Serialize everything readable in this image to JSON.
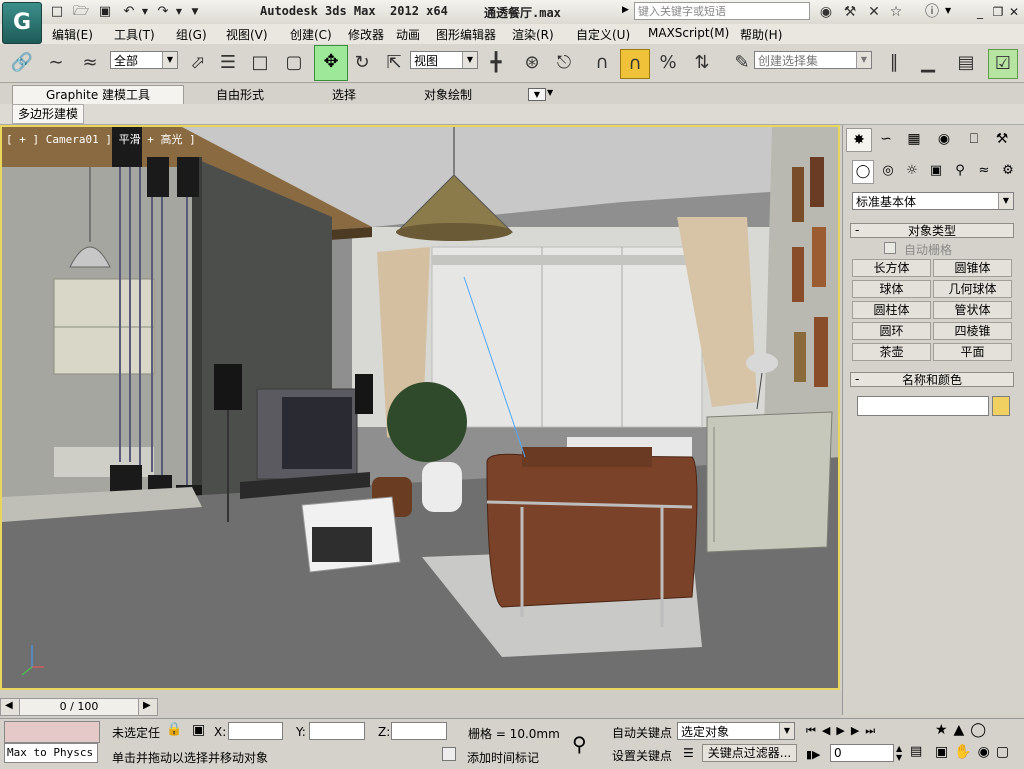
{
  "app_title": "Autodesk 3ds Max  2012 x64",
  "file_title": "通透餐厅.max",
  "search": {
    "placeholder": "键入关键字或短语"
  },
  "menu": [
    "编辑(E)",
    "工具(T)",
    "组(G)",
    "视图(V)",
    "创建(C)",
    "修改器",
    "动画",
    "图形编辑器",
    "渲染(R)",
    "自定义(U)",
    "MAXScript(M)",
    "帮助(H)"
  ],
  "toolbar": {
    "filter_value": "全部",
    "refcoord_value": "视图",
    "named_selection_placeholder": "创建选择集"
  },
  "ribbon": {
    "tabs": [
      "Graphite 建模工具",
      "自由形式",
      "选择",
      "对象绘制"
    ],
    "subtab": "多边形建模"
  },
  "viewport": {
    "label": "[ + ] Camera01 ] 平滑 + 高光 ]"
  },
  "command_panel": {
    "category_value": "标准基本体",
    "object_type_header": "对象类型",
    "autogrid_label": "自动栅格",
    "objects": [
      "长方体",
      "圆锥体",
      "球体",
      "几何球体",
      "圆柱体",
      "管状体",
      "圆环",
      "四棱锥",
      "茶壶",
      "平面"
    ],
    "name_color_header": "名称和颜色",
    "object_color": "#f0d060"
  },
  "timeline": {
    "frame": "0 / 100"
  },
  "status": {
    "script_listener": "Max to Physcs (",
    "selection_text": "未选定任",
    "x_label": "X:",
    "y_label": "Y:",
    "z_label": "Z:",
    "grid_text": "栅格 = 10.0mm",
    "prompt": "单击并拖动以选择并移动对象",
    "add_time_tag": "添加时间标记",
    "auto_key": "自动关键点",
    "set_key": "设置关键点",
    "key_mode_value": "选定对象",
    "key_filters": "关键点过滤器...",
    "frame_value": "0"
  },
  "colors": {
    "viewport_border": "#e9d65c",
    "snap_active": "#9ee89a"
  }
}
